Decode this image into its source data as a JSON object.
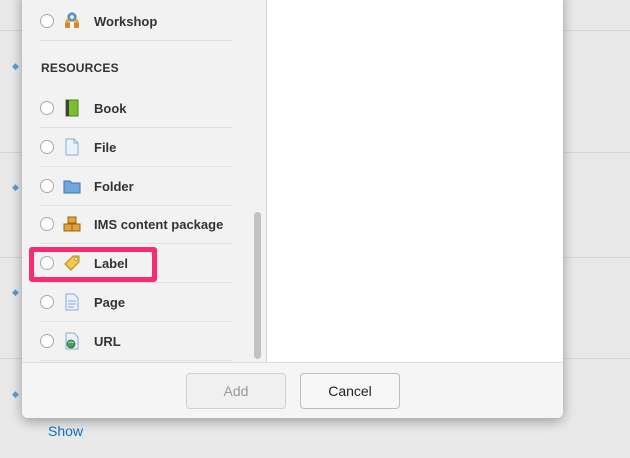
{
  "background": {
    "show_link": "Show"
  },
  "modal": {
    "options": {
      "activities_tail": [
        {
          "label": "Workshop",
          "icon": "workshop-icon"
        }
      ],
      "resources_title": "RESOURCES",
      "resources": [
        {
          "label": "Book",
          "icon": "book-icon"
        },
        {
          "label": "File",
          "icon": "file-icon"
        },
        {
          "label": "Folder",
          "icon": "folder-icon"
        },
        {
          "label": "IMS content package",
          "icon": "package-icon"
        },
        {
          "label": "Label",
          "icon": "label-icon",
          "highlighted": true
        },
        {
          "label": "Page",
          "icon": "page-icon"
        },
        {
          "label": "URL",
          "icon": "url-icon"
        }
      ]
    },
    "footer": {
      "add_label": "Add",
      "cancel_label": "Cancel"
    }
  },
  "colors": {
    "highlight": "#ff2a6d",
    "link": "#0f6fc5"
  }
}
